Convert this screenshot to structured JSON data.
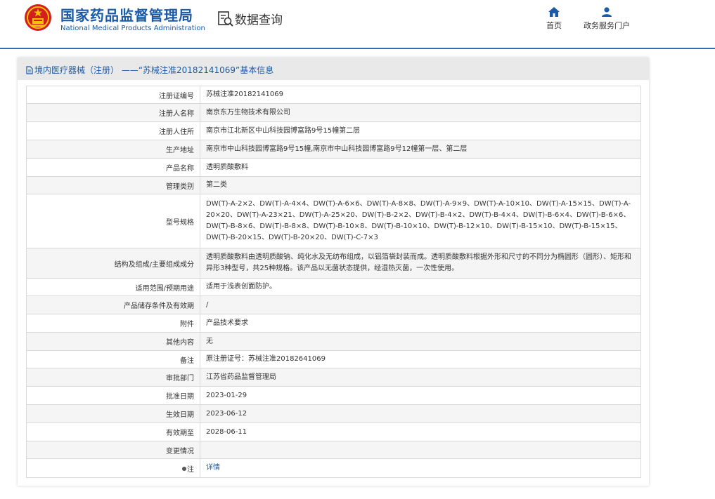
{
  "header": {
    "site_title_cn": "国家药品监督管理局",
    "site_title_en": "National Medical Products Administration",
    "query_title": "数据查询",
    "nav": [
      {
        "label": "首页",
        "icon": "home-icon"
      },
      {
        "label": "政务服务门户",
        "icon": "user-icon"
      }
    ],
    "accent_color": "#1a5aa6"
  },
  "panel": {
    "title": "境内医疗器械（注册） ——“苏械注准20182141069”基本信息"
  },
  "rows": [
    {
      "label": "注册证编号",
      "value": "苏械注准20182141069"
    },
    {
      "label": "注册人名称",
      "value": "南京东万生物技术有限公司"
    },
    {
      "label": "注册人住所",
      "value": "南京市江北新区中山科技园博富路9号15幢第二层"
    },
    {
      "label": "生产地址",
      "value": "南京市中山科技园博富路9号15幢,南京市中山科技园博富路9号12幢第一层、第二层"
    },
    {
      "label": "产品名称",
      "value": "透明质酸敷料"
    },
    {
      "label": "管理类别",
      "value": "第二类"
    },
    {
      "label": "型号规格",
      "value": "DW(T)-A-2×2、DW(T)-A-4×4、DW(T)-A-6×6、DW(T)-A-8×8、DW(T)-A-9×9、DW(T)-A-10×10、DW(T)-A-15×15、DW(T)-A-20×20、DW(T)-A-23×21、DW(T)-A-25×20、DW(T)-B-2×2、DW(T)-B-4×2、DW(T)-B-4×4、DW(T)-B-6×4、DW(T)-B-6×6、DW(T)-B-8×6、DW(T)-B-8×8、DW(T)-B-10×8、DW(T)-B-10×10、DW(T)-B-12×10、DW(T)-B-15×10、DW(T)-B-15×15、DW(T)-B-20×15、DW(T)-B-20×20、DW(T)-C-7×3"
    },
    {
      "label": "结构及组成/主要组成成分",
      "value": "透明质酸敷料由透明质酸钠、纯化水及无纺布组成，以铝箔袋封装而成。透明质酸敷料根据外形和尺寸的不同分为椭圆形（圆形）、矩形和异形3种型号，共25种规格。该产品以无菌状态提供，经湿热灭菌，一次性使用。"
    },
    {
      "label": "适用范围/预期用途",
      "value": "适用于浅表创面防护。"
    },
    {
      "label": "产品储存条件及有效期",
      "value": "/"
    },
    {
      "label": "附件",
      "value": "产品技术要求"
    },
    {
      "label": "其他内容",
      "value": "无"
    },
    {
      "label": "备注",
      "value": "原注册证号：苏械注准20182641069"
    },
    {
      "label": "审批部门",
      "value": "江苏省药品监督管理局"
    },
    {
      "label": "批准日期",
      "value": "2023-01-29"
    },
    {
      "label": "生效日期",
      "value": "2023-06-12"
    },
    {
      "label": "有效期至",
      "value": "2028-06-11"
    },
    {
      "label": "变更情况",
      "value": ""
    },
    {
      "label": "注",
      "value": "详情"
    }
  ]
}
